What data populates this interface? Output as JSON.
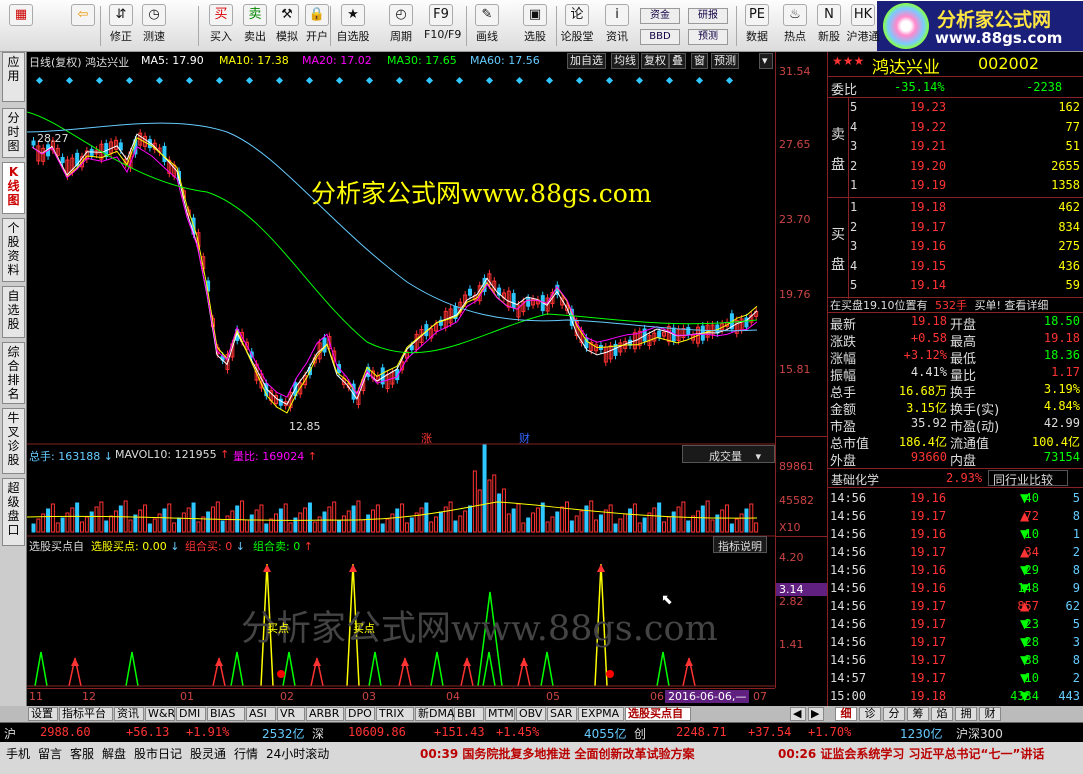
{
  "toolbar": {
    "buttons": [
      {
        "label": "",
        "icon": "grid-icon"
      },
      {
        "label": "",
        "icon": "back-arrow-icon"
      },
      {
        "label": "修正",
        "icon": "up-down-icon"
      },
      {
        "label": "测速",
        "icon": "clock-icon"
      },
      {
        "label": "买入",
        "icon": "buy-icon",
        "glyph": "买"
      },
      {
        "label": "卖出",
        "icon": "sell-icon",
        "glyph": "卖"
      },
      {
        "label": "模拟",
        "icon": "hammer-icon"
      },
      {
        "label": "开户",
        "icon": "lock-icon"
      },
      {
        "label": "自选股",
        "icon": "star-icon"
      },
      {
        "label": "周期",
        "icon": "period-clock-icon"
      },
      {
        "label": "F10/F9",
        "icon": "f10-icon"
      },
      {
        "label": "画线",
        "icon": "pen-icon"
      },
      {
        "label": "选股",
        "icon": "select-stock-icon"
      },
      {
        "label": "论股堂",
        "icon": "discuss-icon"
      },
      {
        "label": "资讯",
        "icon": "news-icon"
      },
      {
        "label": "数据",
        "icon": "pe-data-icon"
      },
      {
        "label": "热点",
        "icon": "hot-icon"
      },
      {
        "label": "新股",
        "icon": "new-stock-icon"
      },
      {
        "label": "沪港通",
        "icon": "hk-connect-icon"
      }
    ],
    "small_buttons": [
      "资金",
      "研报",
      "BBD",
      "预测"
    ],
    "logo_title": "分析家公式网",
    "logo_url": "www.88gs.com"
  },
  "left_tabs": [
    "应用",
    "分时图",
    "K线图",
    "个股资料",
    "自选股",
    "综合排名",
    "牛叉诊股",
    "超级盘口"
  ],
  "chart_header": {
    "title": "日线(复权) 鸿达兴业",
    "ma5": "MA5: 17.90",
    "ma10": "MA10: 17.38",
    "ma20": "MA20: 17.02",
    "ma30": "MA30: 17.65",
    "ma60": "MA60: 17.56",
    "buttons": [
      "加自选",
      "均线",
      "复权",
      "叠",
      "窗",
      "预测"
    ]
  },
  "watermark": "分析家公式网www.88gs.com",
  "watermark2": "分析家公式网www.88gs.com",
  "price_axis": [
    "31.54",
    "27.65",
    "23.70",
    "19.76",
    "15.81"
  ],
  "annotations": {
    "high": "28.27",
    "low": "12.85",
    "zhang": "涨",
    "cai": "财"
  },
  "volume_header": {
    "total": "总手: 163188",
    "mavol": "MAVOL10: 121955",
    "ratio": "量比: 169024",
    "dropdown": "成交量"
  },
  "volume_axis": [
    "89861",
    "45582",
    "X10"
  ],
  "indicator_header": {
    "name": "选股买点自",
    "value": "选股买点: 0.00",
    "buy": "组合买: 0",
    "sell": "组合卖: 0",
    "help": "指标说明"
  },
  "indicator_axis": [
    "4.20",
    "3.14",
    "2.82",
    "1.41"
  ],
  "indicator_labels": [
    "买点",
    "买点"
  ],
  "x_axis": [
    "11",
    "12",
    "01",
    "02",
    "03",
    "04",
    "05",
    "06",
    "07"
  ],
  "x_date": "2016-06-06,—",
  "quote": {
    "name": "鸿达兴业",
    "code": "002002",
    "wei_bi": "委比",
    "wei_bi_pct": "-35.14%",
    "wei_bi_diff": "-2238",
    "sell_label": "卖盘",
    "buy_label": "买盘",
    "sells": [
      {
        "lvl": "5",
        "price": "19.23",
        "vol": "162"
      },
      {
        "lvl": "4",
        "price": "19.22",
        "vol": "77"
      },
      {
        "lvl": "3",
        "price": "19.21",
        "vol": "51"
      },
      {
        "lvl": "2",
        "price": "19.20",
        "vol": "2655"
      },
      {
        "lvl": "1",
        "price": "19.19",
        "vol": "1358"
      }
    ],
    "buys": [
      {
        "lvl": "1",
        "price": "19.18",
        "vol": "462"
      },
      {
        "lvl": "2",
        "price": "19.17",
        "vol": "834"
      },
      {
        "lvl": "3",
        "price": "19.16",
        "vol": "275"
      },
      {
        "lvl": "4",
        "price": "19.15",
        "vol": "436"
      },
      {
        "lvl": "5",
        "price": "19.14",
        "vol": "59"
      }
    ],
    "notice_pre": "在买盘19.10位置有",
    "notice_vol": "532手",
    "notice_post": "买单! 查看详细",
    "stats": [
      [
        "最新",
        "19.18",
        "开盘",
        "18.50"
      ],
      [
        "涨跌",
        "+0.58",
        "最高",
        "19.18"
      ],
      [
        "涨幅",
        "+3.12%",
        "最低",
        "18.36"
      ],
      [
        "振幅",
        "4.41%",
        "量比",
        "1.17"
      ],
      [
        "总手",
        "16.68万",
        "换手",
        "3.19%"
      ],
      [
        "金额",
        "3.15亿",
        "换手(实)",
        "4.84%"
      ],
      [
        "市盈",
        "35.92",
        "市盈(动)",
        "42.99"
      ],
      [
        "总市值",
        "186.4亿",
        "流通值",
        "100.4亿"
      ],
      [
        "外盘",
        "93660",
        "内盘",
        "73154"
      ]
    ],
    "sector": "基础化学",
    "sector_pct": "2.93%",
    "compare": "同行业比较",
    "ticks": [
      [
        "14:56",
        "19.16",
        "40",
        "down",
        "5"
      ],
      [
        "14:56",
        "19.17",
        "72",
        "up",
        "8"
      ],
      [
        "14:56",
        "19.16",
        "10",
        "down",
        "1"
      ],
      [
        "14:56",
        "19.17",
        "34",
        "up",
        "2"
      ],
      [
        "14:56",
        "19.16",
        "29",
        "down",
        "8"
      ],
      [
        "14:56",
        "19.16",
        "148",
        "down",
        "9"
      ],
      [
        "14:56",
        "19.17",
        "857",
        "up",
        "62"
      ],
      [
        "14:56",
        "19.17",
        "23",
        "down",
        "5"
      ],
      [
        "14:56",
        "19.17",
        "28",
        "down",
        "3"
      ],
      [
        "14:56",
        "19.17",
        "38",
        "down",
        "8"
      ],
      [
        "14:57",
        "19.17",
        "10",
        "down",
        "2"
      ],
      [
        "15:00",
        "19.18",
        "4334",
        "down",
        "443"
      ]
    ]
  },
  "bottom_tabs": [
    "设置",
    "指标平台",
    "资讯",
    "W&R",
    "DMI",
    "BIAS",
    "ASI",
    "VR",
    "ARBR",
    "DPO",
    "TRIX",
    "新DMA",
    "BBI",
    "MTM",
    "OBV",
    "SAR",
    "EXPMA",
    "选股买点自"
  ],
  "right_tabs": [
    "细",
    "诊",
    "分",
    "筹",
    "焰",
    "拥",
    "财"
  ],
  "status1": {
    "sh": "沪",
    "sh_idx": "2988.60",
    "sh_chg": "+56.13",
    "sh_pct": "+1.91%",
    "sh_amt": "2532亿",
    "sz": "深",
    "sz_idx": "10609.86",
    "sz_chg": "+151.43",
    "sz_pct": "+1.45%",
    "sz_amt": "4055亿",
    "cy": "创",
    "cy_idx": "2248.71",
    "cy_chg": "+37.54",
    "cy_pct": "+1.70%",
    "cy_amt": "1230亿",
    "hs": "沪深300"
  },
  "status2": {
    "items": [
      "手机",
      "留言",
      "客服",
      "解盘",
      "股市日记",
      "股灵通",
      "行情",
      "24小时滚动"
    ],
    "news1": "00:39 国务院批复多地推进 全面创新改革试验方案",
    "news2": "00:26 证监会系统学习 习近平总书记“七一”讲话"
  }
}
